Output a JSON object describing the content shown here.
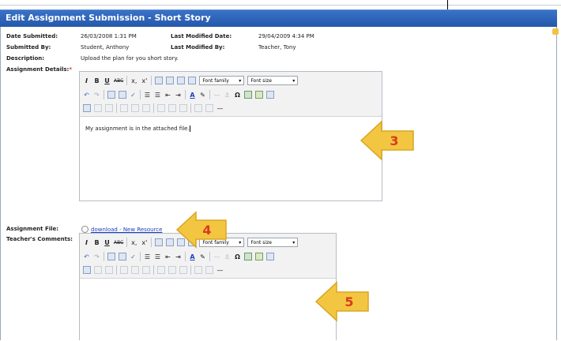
{
  "window": {
    "title": "Edit Assignment Submission - Short Story"
  },
  "fields": {
    "date_submitted_label": "Date Submitted:",
    "date_submitted_value": "26/03/2008 1:31 PM",
    "last_modified_date_label": "Last Modified Date:",
    "last_modified_date_value": "29/04/2009 4:34 PM",
    "submitted_by_label": "Submitted By:",
    "submitted_by_value": "Student, Anthony",
    "last_modified_by_label": "Last Modified By:",
    "last_modified_by_value": "Teacher, Tony",
    "description_label": "Description:",
    "description_value": "Upload the plan for you short story.",
    "assignment_details_label": "Assignment Details:",
    "required_marker": "*",
    "assignment_file_label": "Assignment File:",
    "assignment_file_link": "download - New Resource",
    "teachers_comments_label": "Teacher's Comments:"
  },
  "editor": {
    "font_family": "Font family",
    "font_size": "Font size",
    "italic": "I",
    "bold": "B",
    "underline": "U",
    "strike": "ABC",
    "subscript": "x,",
    "superscript": "x'",
    "font_color": "A",
    "omega": "Ω",
    "assignment_content": "My assignment is in the attached file."
  },
  "callouts": {
    "three": "3",
    "four": "4",
    "five": "5"
  },
  "colors": {
    "titlebar": "#2a5fb3",
    "callout_fill": "#f3c642",
    "callout_text": "#d83b1e"
  }
}
